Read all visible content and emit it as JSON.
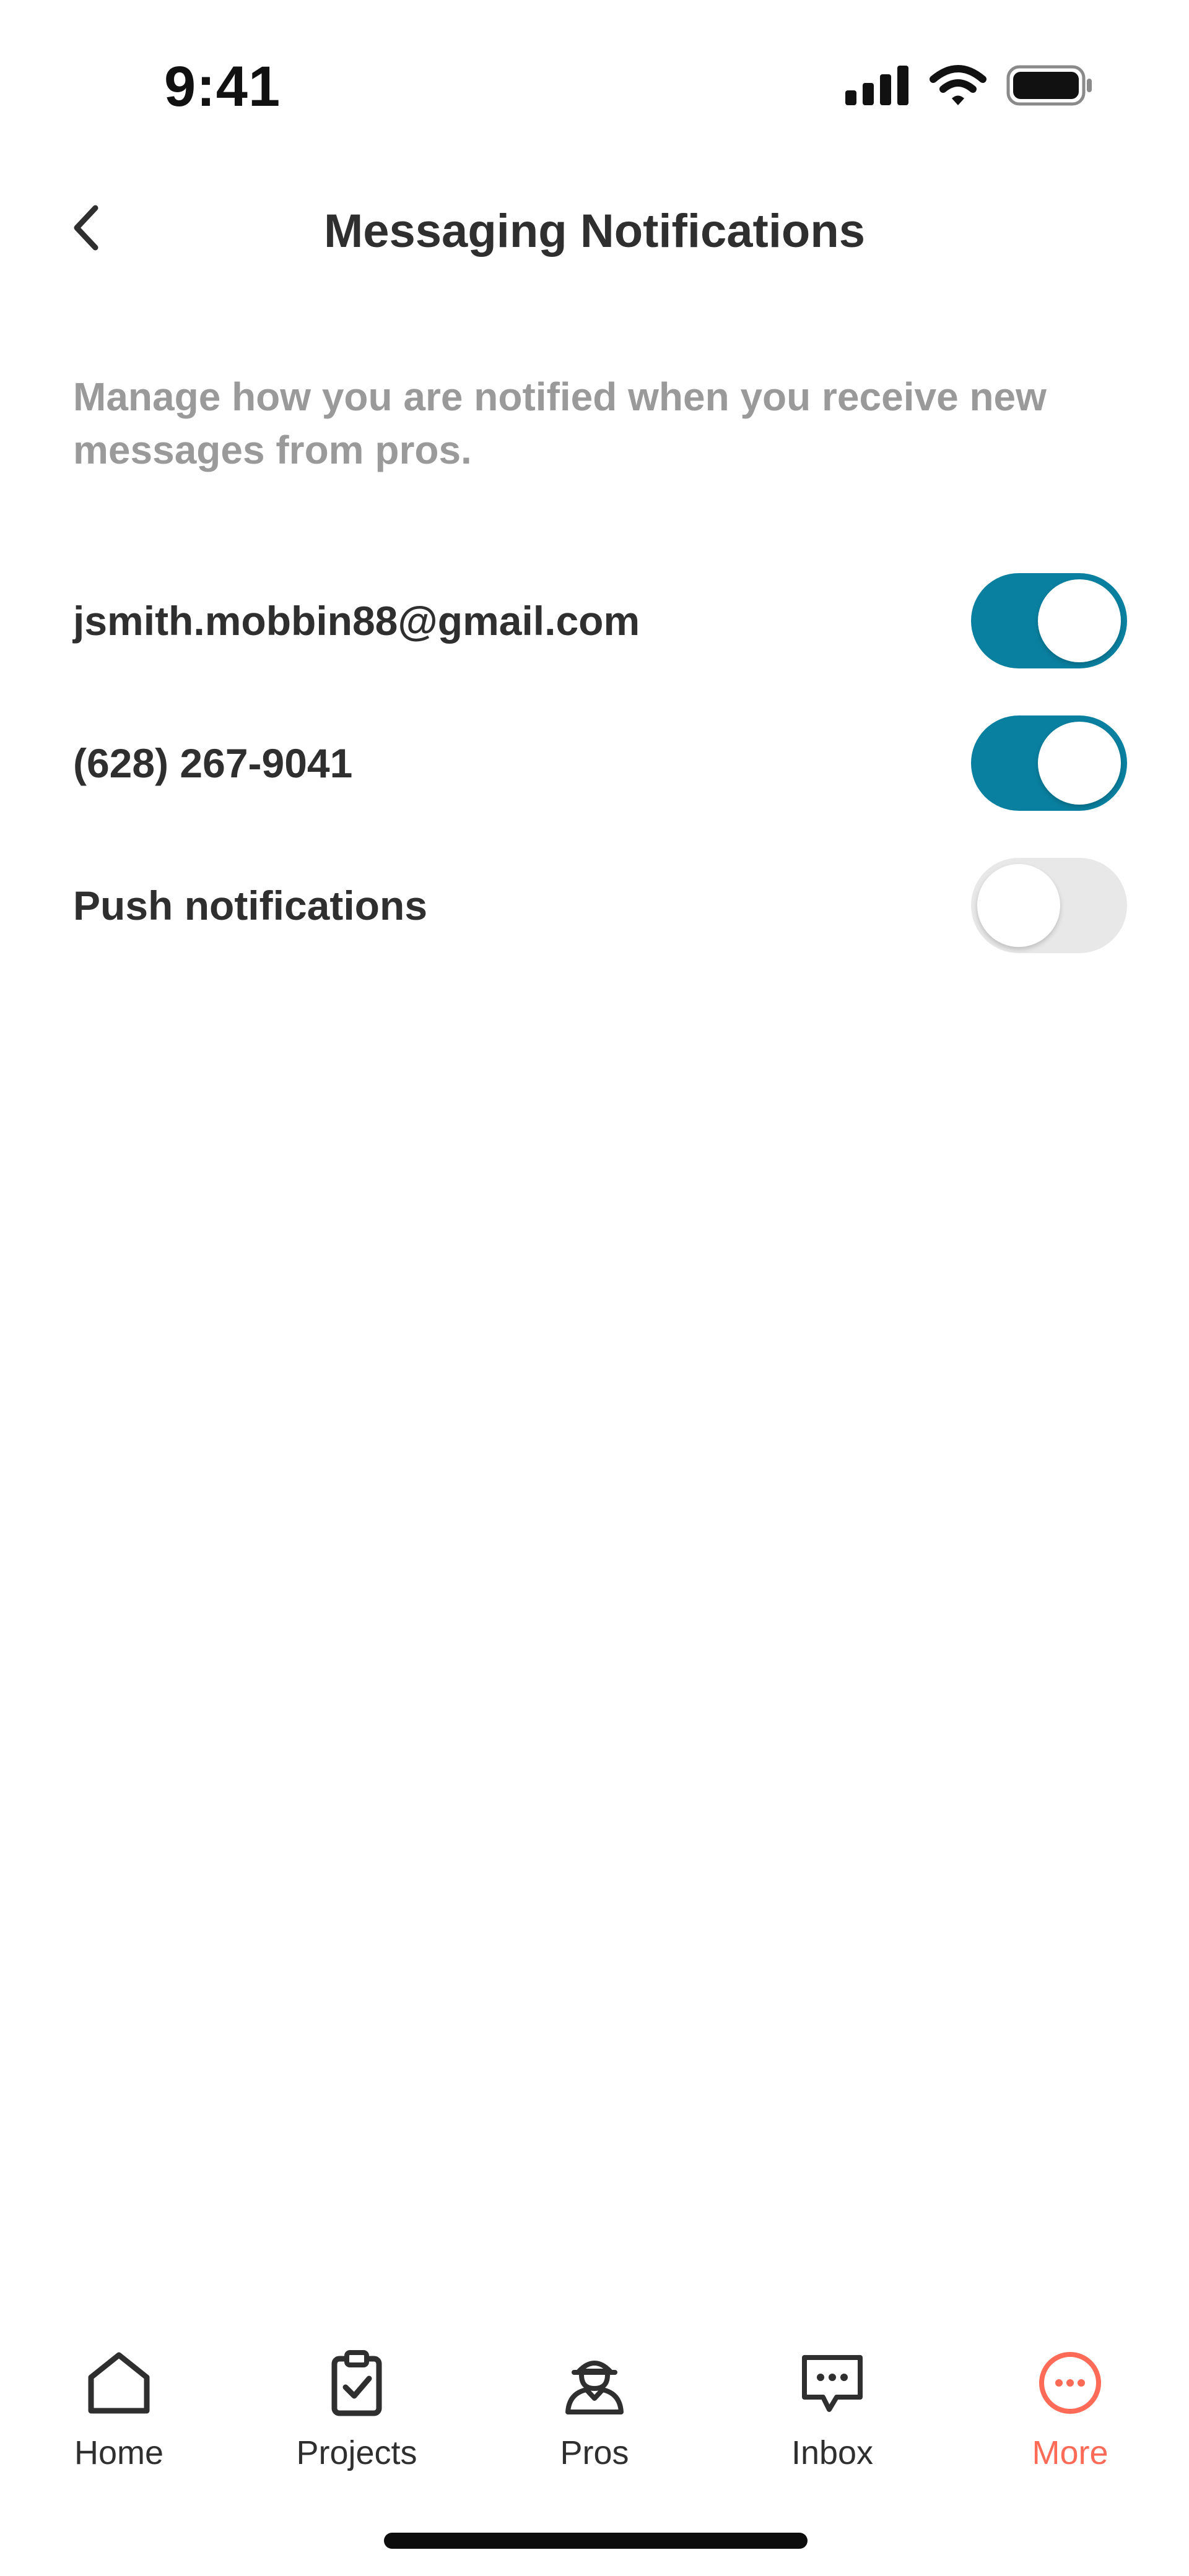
{
  "status_bar": {
    "time": "9:41",
    "icons": [
      "signal-icon",
      "wifi-icon",
      "battery-icon"
    ]
  },
  "header": {
    "title": "Messaging Notifications",
    "back_icon": "chevron-left-icon"
  },
  "description": "Manage how you are notified when you receive new messages from pros.",
  "settings": [
    {
      "label": "jsmith.mobbin88@gmail.com",
      "enabled": true
    },
    {
      "label": "(628) 267-9041",
      "enabled": true
    },
    {
      "label": "Push notifications",
      "enabled": false
    }
  ],
  "tabs": [
    {
      "label": "Home",
      "icon": "home-icon",
      "active": false
    },
    {
      "label": "Projects",
      "icon": "clipboard-check-icon",
      "active": false
    },
    {
      "label": "Pros",
      "icon": "pro-worker-icon",
      "active": false
    },
    {
      "label": "Inbox",
      "icon": "chat-bubble-icon",
      "active": false
    },
    {
      "label": "More",
      "icon": "more-circle-icon",
      "active": true
    }
  ],
  "colors": {
    "toggle_on": "#0a80a0",
    "toggle_off": "#e8e8e8",
    "active_tab": "#ff6b57",
    "description_text": "#9a9a9a"
  }
}
